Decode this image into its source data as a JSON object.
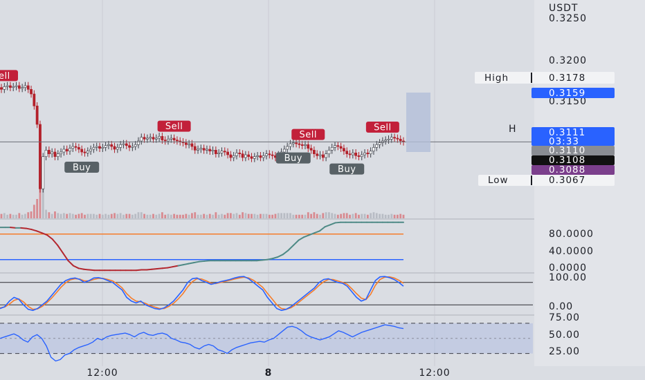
{
  "colors": {
    "background": "#dadde3",
    "axis_background": "#e2e4e9",
    "grid": "#c9ccd3",
    "up_candle": "#ffffff",
    "down_candle": "#b3202a",
    "sell_badge": "#c2203a",
    "buy_badge": "#586166",
    "stoch_k": "#2962ff",
    "stoch_d": "#f57c2a",
    "rsi_line": "#2962ff",
    "trend_low": "#b3262e",
    "trend_high": "#4e8a86",
    "level_high": "#f57c2a",
    "level_low": "#2962ff",
    "high_low_tag": "#f2f3f5",
    "last_price_tag": "#2962ff",
    "purple_tag": "#7b3f8c",
    "black_tag": "#111111",
    "grey_tag": "#8a8d93"
  },
  "header": {
    "currency": "USDT"
  },
  "price_axis": {
    "ticks": [
      "0.3250",
      "0.3200",
      "0.3150"
    ]
  },
  "tags": {
    "high_label": "High",
    "high_value": "0.3178",
    "blue_value": "0.3159",
    "last_value": "0.3111",
    "countdown": "03:33",
    "grey_value": "0.3110",
    "black_value": "0.3108",
    "purple_value": "0.3088",
    "low_label": "Low",
    "low_value": "0.3067",
    "h_marker": "H"
  },
  "panes": {
    "trend": {
      "ticks": [
        "80.0000",
        "40.0000",
        "0.0000"
      ]
    },
    "stoch": {
      "ticks": [
        "100.00",
        "0.00"
      ]
    },
    "rsi": {
      "ticks": [
        "75.00",
        "50.00",
        "25.00"
      ]
    }
  },
  "time_axis": {
    "labels": [
      "12:00",
      "8",
      "12:00"
    ]
  },
  "signals": [
    {
      "type": "sell",
      "label": "Sell",
      "index": 0
    },
    {
      "type": "buy",
      "label": "Buy",
      "index": 27
    },
    {
      "type": "sell",
      "label": "Sell",
      "index": 58
    },
    {
      "type": "buy",
      "label": "Buy",
      "index": 98
    },
    {
      "type": "sell",
      "label": "Sell",
      "index": 103
    },
    {
      "type": "buy",
      "label": "Buy",
      "index": 116
    },
    {
      "type": "sell",
      "label": "Sell",
      "index": 128
    }
  ],
  "chart_data": [
    {
      "type": "candlestick",
      "ylim": [
        0.304,
        0.3265
      ],
      "series": [
        {
          "values": [
            0.3168,
            0.3171,
            0.3172,
            0.317,
            0.3171,
            0.3172,
            0.3169,
            0.317,
            0.3172,
            0.3168,
            0.3163,
            0.315,
            0.313,
            0.306,
            0.3095,
            0.3102,
            0.3098,
            0.31,
            0.3095,
            0.3098,
            0.31,
            0.3103,
            0.3101,
            0.3104,
            0.3106,
            0.3105,
            0.3103,
            0.31,
            0.3099,
            0.3101,
            0.3103,
            0.3105,
            0.3106,
            0.3104,
            0.3105,
            0.3107,
            0.3108,
            0.3106,
            0.3103,
            0.3105,
            0.3108,
            0.3109,
            0.3107,
            0.3105,
            0.3106,
            0.3108,
            0.3112,
            0.3116,
            0.3114,
            0.3115,
            0.3116,
            0.3114,
            0.3115,
            0.3117,
            0.3113,
            0.3112,
            0.3114,
            0.3115,
            0.3113,
            0.3112,
            0.3111,
            0.311,
            0.3108,
            0.3109,
            0.3106,
            0.3102,
            0.3103,
            0.3104,
            0.3102,
            0.3103,
            0.3101,
            0.3102,
            0.3098,
            0.3099,
            0.3101,
            0.31,
            0.3097,
            0.3094,
            0.3096,
            0.3099,
            0.3098,
            0.3094,
            0.3097,
            0.3095,
            0.3093,
            0.3095,
            0.3096,
            0.3094,
            0.3096,
            0.3098,
            0.3097,
            0.3096,
            0.3094,
            0.3097,
            0.31,
            0.3103,
            0.3106,
            0.3109,
            0.311,
            0.3109,
            0.3108,
            0.3107,
            0.3108,
            0.3104,
            0.3102,
            0.3098,
            0.3096,
            0.3097,
            0.3094,
            0.3098,
            0.3102,
            0.3105,
            0.3107,
            0.3106,
            0.3104,
            0.3101,
            0.3098,
            0.3097,
            0.3099,
            0.3096,
            0.3095,
            0.3097,
            0.3099,
            0.3098,
            0.3101,
            0.3105,
            0.3108,
            0.311,
            0.3112,
            0.3113,
            0.3114,
            0.3116,
            0.3115,
            0.3114,
            0.3112,
            0.3111
          ]
        }
      ],
      "ma": {
        "value": 0.3111
      }
    },
    {
      "type": "line",
      "title": "",
      "ylim": [
        0,
        100
      ],
      "levels": [
        72,
        22
      ],
      "series": [
        {
          "values": [
            85,
            85,
            85,
            84,
            84,
            83,
            81,
            78,
            74,
            70,
            62,
            50,
            35,
            20,
            10,
            5,
            3,
            2,
            1,
            1,
            1,
            1,
            1,
            1,
            1,
            1,
            1,
            2,
            2,
            3,
            4,
            5,
            6,
            8,
            10,
            12,
            14,
            16,
            18,
            19,
            20,
            20,
            20,
            20,
            20,
            20,
            20,
            20,
            20,
            20,
            21,
            22,
            24,
            27,
            32,
            40,
            50,
            60,
            66,
            70,
            74,
            78,
            86,
            90,
            94,
            95,
            95,
            95,
            95,
            95,
            95,
            95,
            95,
            95,
            95,
            95,
            95,
            95
          ]
        }
      ]
    },
    {
      "type": "line",
      "title": "",
      "ylim": [
        0,
        100
      ],
      "levels": [
        80,
        20
      ],
      "series": [
        {
          "name": "K",
          "values": [
            10,
            15,
            30,
            40,
            35,
            20,
            8,
            5,
            10,
            20,
            30,
            45,
            60,
            75,
            85,
            90,
            92,
            88,
            80,
            85,
            92,
            93,
            90,
            85,
            80,
            70,
            60,
            40,
            30,
            25,
            30,
            20,
            15,
            10,
            8,
            12,
            20,
            30,
            45,
            60,
            80,
            90,
            92,
            85,
            80,
            75,
            78,
            82,
            85,
            88,
            92,
            95,
            96,
            90,
            80,
            70,
            60,
            40,
            25,
            10,
            5,
            8,
            15,
            25,
            35,
            45,
            55,
            65,
            80,
            88,
            90,
            85,
            80,
            78,
            70,
            55,
            40,
            30,
            35,
            60,
            85,
            95,
            96,
            93,
            88,
            80,
            70
          ]
        },
        {
          "name": "D",
          "values": [
            12,
            14,
            22,
            32,
            36,
            28,
            16,
            8,
            9,
            16,
            26,
            38,
            52,
            67,
            79,
            87,
            90,
            89,
            84,
            84,
            88,
            91,
            91,
            88,
            84,
            76,
            66,
            50,
            38,
            30,
            28,
            24,
            18,
            14,
            10,
            10,
            16,
            24,
            36,
            50,
            68,
            82,
            90,
            89,
            84,
            78,
            77,
            80,
            83,
            86,
            89,
            92,
            94,
            92,
            86,
            77,
            67,
            51,
            36,
            20,
            10,
            8,
            12,
            20,
            30,
            40,
            50,
            60,
            72,
            82,
            88,
            88,
            84,
            80,
            75,
            63,
            50,
            38,
            34,
            48,
            72,
            88,
            94,
            95,
            92,
            86,
            78
          ]
        }
      ]
    },
    {
      "type": "line",
      "title": "",
      "ylim": [
        15,
        80
      ],
      "levels": [
        70,
        50,
        30
      ],
      "series": [
        {
          "values": [
            50,
            52,
            54,
            56,
            53,
            48,
            45,
            52,
            55,
            50,
            40,
            25,
            20,
            22,
            28,
            30,
            35,
            38,
            40,
            42,
            45,
            50,
            48,
            52,
            54,
            55,
            56,
            57,
            55,
            52,
            56,
            58,
            55,
            54,
            56,
            57,
            55,
            50,
            48,
            45,
            44,
            42,
            38,
            36,
            40,
            42,
            40,
            35,
            33,
            30,
            35,
            38,
            40,
            42,
            44,
            45,
            46,
            45,
            48,
            50,
            55,
            60,
            65,
            66,
            64,
            60,
            55,
            52,
            50,
            48,
            50,
            52,
            56,
            60,
            58,
            55,
            52,
            55,
            58,
            60,
            62,
            64,
            66,
            68,
            67,
            66,
            64,
            63
          ]
        }
      ]
    }
  ]
}
